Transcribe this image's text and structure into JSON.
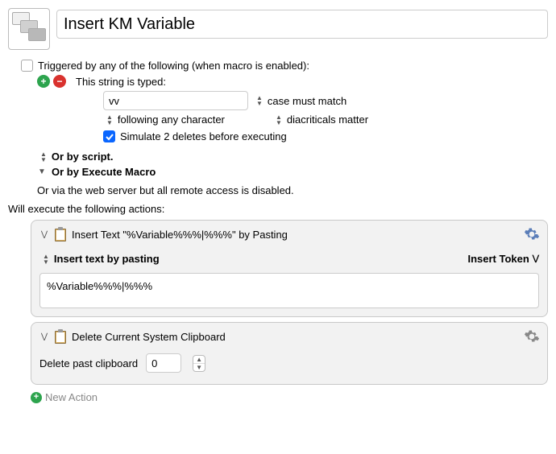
{
  "header": {
    "title": "Insert KM Variable"
  },
  "trigger": {
    "label": "Triggered by any of the following (when macro is enabled):",
    "type_label": "This string is typed:",
    "string_value": "vv",
    "case_option": "case must match",
    "following_option": "following any character",
    "diacriticals_option": "diacriticals matter",
    "simulate_label": "Simulate 2 deletes before executing",
    "simulate_checked": true,
    "script_line": "Or by script.",
    "execute_macro_line": "Or by Execute Macro",
    "web_line": "Or via the web server but all remote access is disabled."
  },
  "actions_label": "Will execute the following actions:",
  "actions": [
    {
      "title": "Insert Text \"%Variable%%%|%%%\" by Pasting",
      "mode_label": "Insert text by pasting",
      "token_label": "Insert Token",
      "text_value": "%Variable%%%|%%%"
    },
    {
      "title": "Delete Current System Clipboard",
      "past_label": "Delete past clipboard",
      "past_value": "0"
    }
  ],
  "new_action_label": "New Action"
}
